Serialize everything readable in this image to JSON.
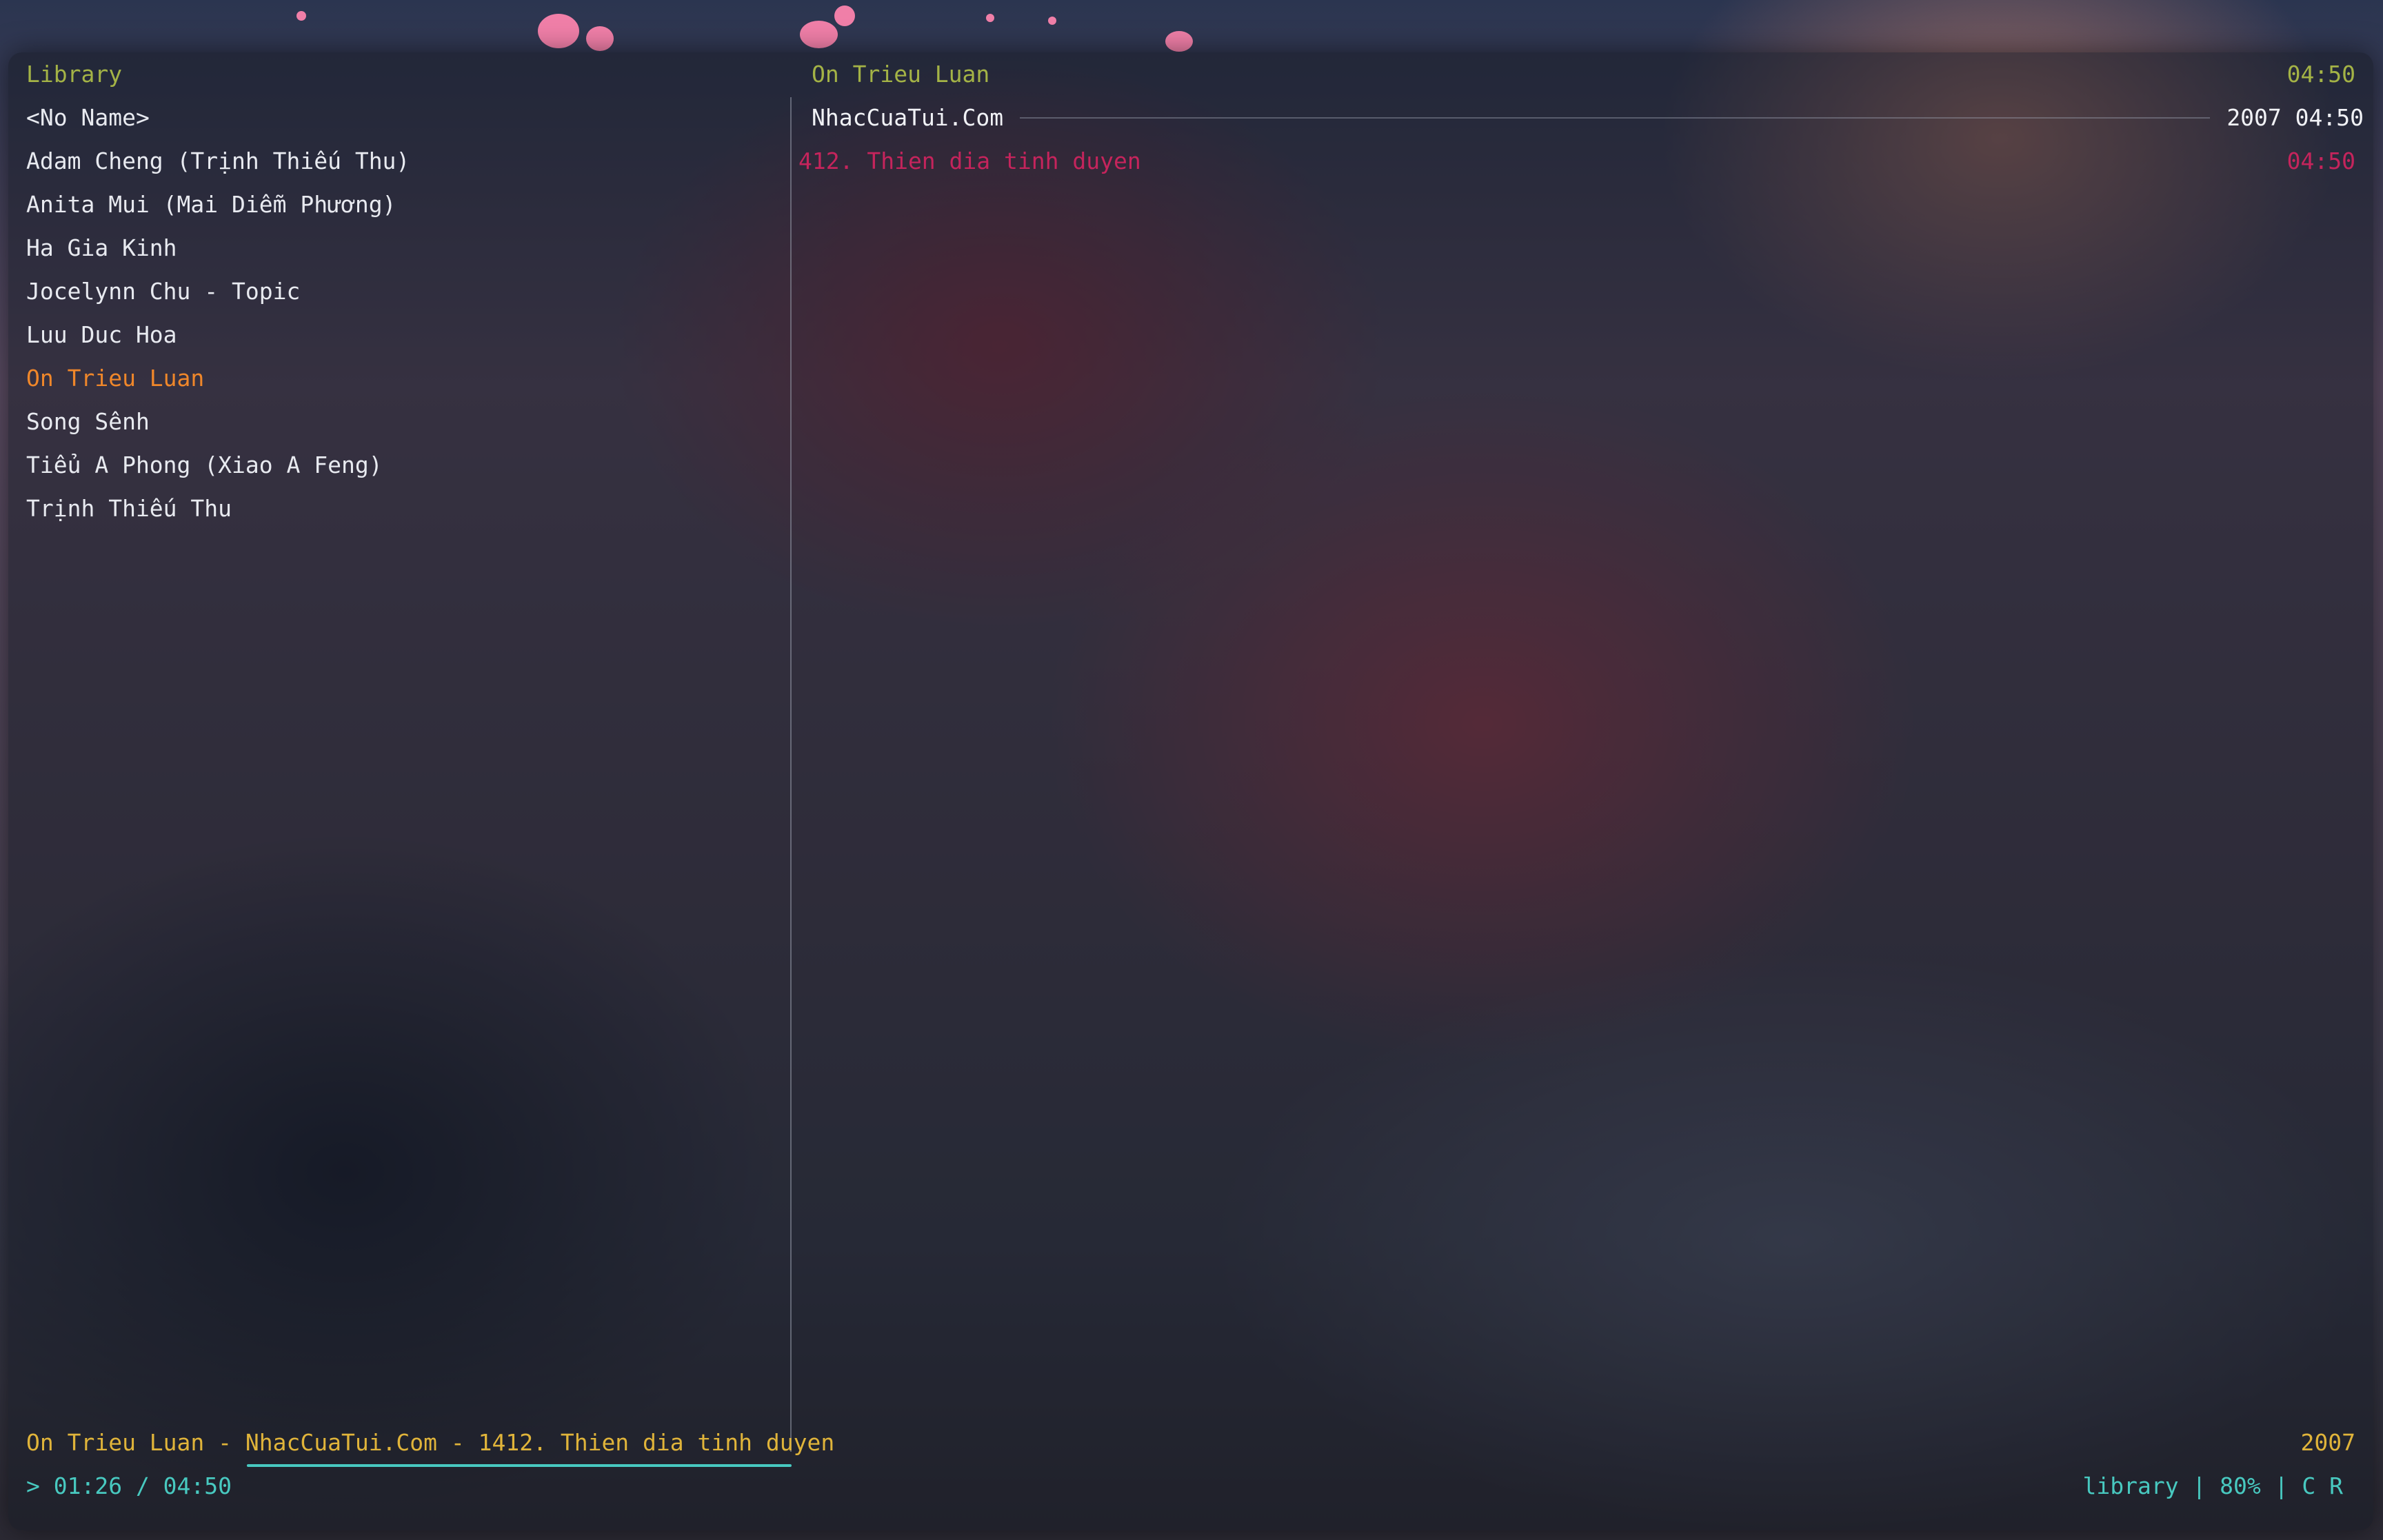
{
  "colors": {
    "pane_title": "#a4b346",
    "text": "#e8eaf0",
    "selected": "#f0872a",
    "track_playing": "#c5245c",
    "now_playing": "#e0b43a",
    "progress": "#48c9c0"
  },
  "library": {
    "title": "Library",
    "items": [
      "<No Name>",
      "Adam Cheng (Trịnh Thiếu Thu)",
      "Anita Mui (Mai Diễm Phương)",
      "Ha Gia Kinh",
      "Jocelynn Chu - Topic",
      "Luu Duc Hoa",
      "On Trieu Luan",
      "Song Sênh",
      "Tiểu A Phong (Xiao A Feng)",
      "Trịnh Thiếu Thu"
    ],
    "selected_index": 6
  },
  "artist_pane": {
    "title": "On Trieu Luan",
    "total_duration": "04:50",
    "album": {
      "name": "NhacCuaTui.Com",
      "meta": "2007 04:50"
    },
    "tracks": [
      {
        "title": "412. Thien dia tinh duyen",
        "duration": "04:50"
      }
    ]
  },
  "now_playing": {
    "line": "On Trieu Luan - NhacCuaTui.Com - 1412. Thien dia tinh duyen",
    "year": "2007",
    "progress_text": "> 01:26 / 04:50",
    "progress_fraction": 0.296,
    "status": "library | 80% | C R"
  }
}
